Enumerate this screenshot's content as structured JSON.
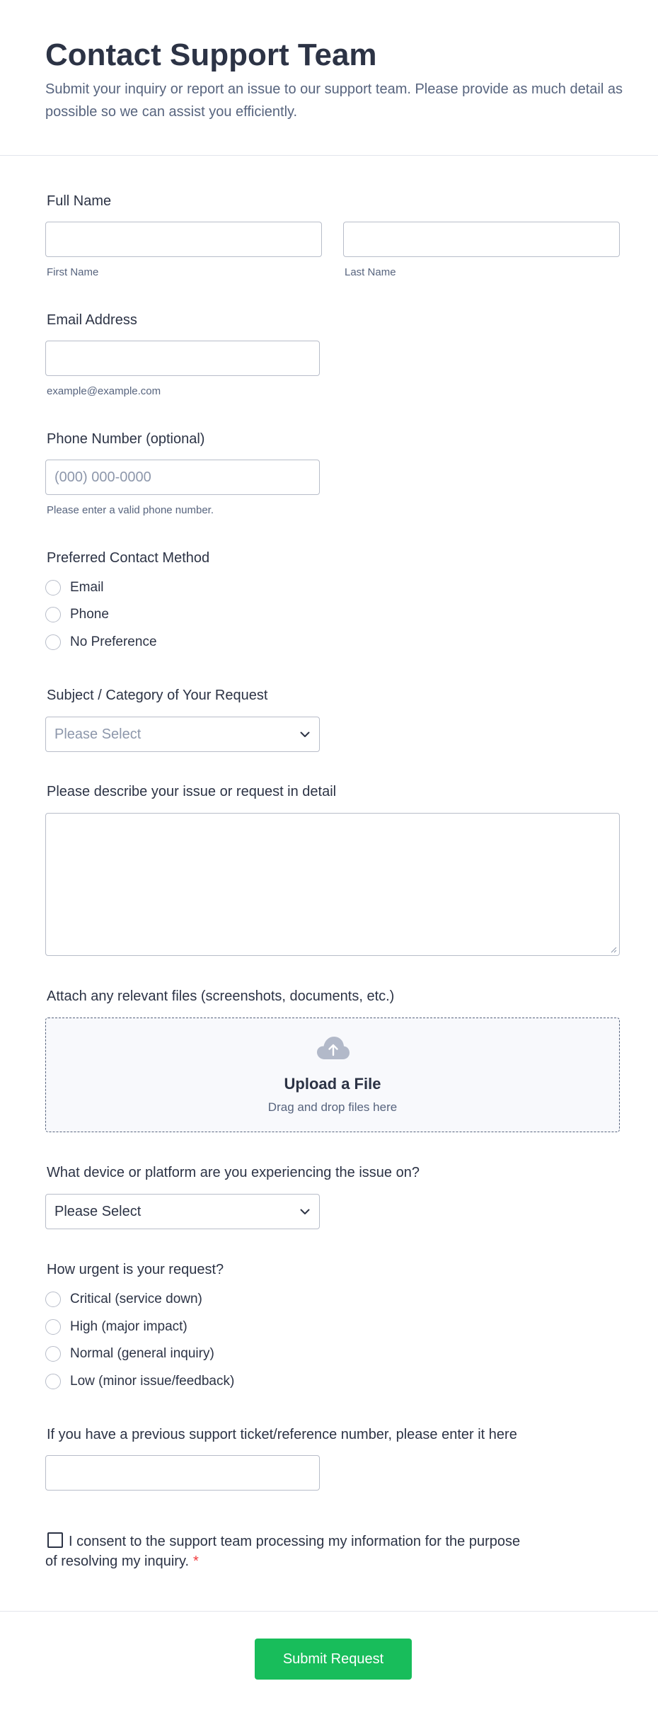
{
  "header": {
    "title": "Contact Support Team",
    "subtitle": "Submit your inquiry or report an issue to our support team. Please provide as much detail as possible so we can assist you efficiently."
  },
  "full_name": {
    "label": "Full Name",
    "first_value": "",
    "last_value": "",
    "first_sublabel": "First Name",
    "last_sublabel": "Last Name"
  },
  "email": {
    "label": "Email Address",
    "value": "",
    "sublabel": "example@example.com"
  },
  "phone": {
    "label": "Phone Number (optional)",
    "value": "",
    "placeholder": "(000) 000-0000",
    "sublabel": "Please enter a valid phone number."
  },
  "contact_method": {
    "label": "Preferred Contact Method",
    "options": [
      "Email",
      "Phone",
      "No Preference"
    ]
  },
  "subject": {
    "label": "Subject / Category of Your Request",
    "selected": "Please Select"
  },
  "description": {
    "label": "Please describe your issue or request in detail",
    "value": ""
  },
  "attachment": {
    "label": "Attach any relevant files (screenshots, documents, etc.)",
    "upload_title": "Upload a File",
    "upload_hint": "Drag and drop files here"
  },
  "device": {
    "label": "What device or platform are you experiencing the issue on?",
    "selected": "Please Select"
  },
  "urgency": {
    "label": "How urgent is your request?",
    "options": [
      "Critical (service down)",
      "High (major impact)",
      "Normal (general inquiry)",
      "Low (minor issue/feedback)"
    ]
  },
  "ticket": {
    "label": "If you have a previous support ticket/reference number, please enter it here",
    "value": ""
  },
  "consent": {
    "text": "I consent to the support team processing my information for the purpose of resolving my inquiry.",
    "required_mark": "*"
  },
  "footer": {
    "submit_label": "Submit Request"
  },
  "colors": {
    "accent_green": "#18bd5b",
    "text_primary": "#2c3345",
    "text_secondary": "#57647e",
    "border": "#b8bdc9",
    "required_red": "#f23a3c"
  }
}
